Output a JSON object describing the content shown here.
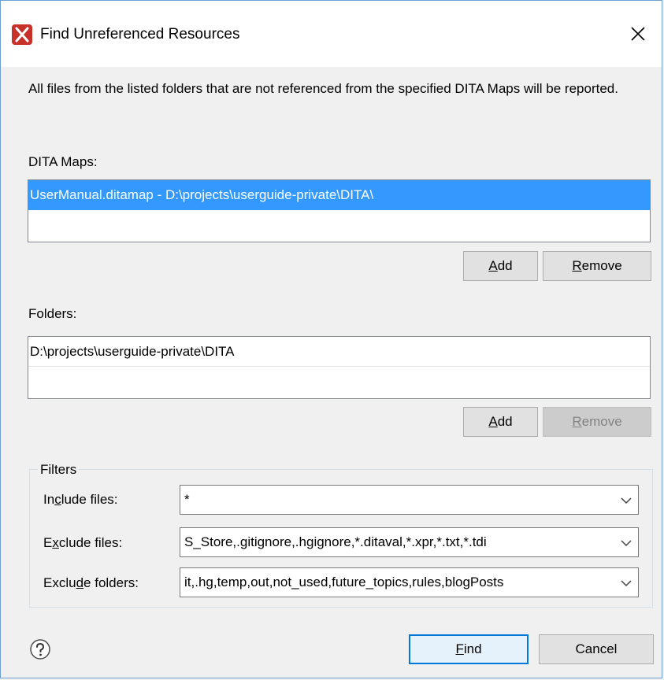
{
  "dialog": {
    "title": "Find Unreferenced Resources",
    "description": "All files from the listed folders that are not referenced from the specified DITA Maps will be reported."
  },
  "dita_maps": {
    "label": "DITA Maps:",
    "items": [
      "UserManual.ditamap - D:\\projects\\userguide-private\\DITA\\"
    ],
    "selected_index": 0,
    "add_button": {
      "mnemonic": "A",
      "rest": "dd"
    },
    "remove_button": {
      "mnemonic": "R",
      "rest": "emove"
    }
  },
  "folders": {
    "label": "Folders:",
    "items": [
      "D:\\projects\\userguide-private\\DITA"
    ],
    "add_button": {
      "mnemonic": "A",
      "rest": "dd"
    },
    "remove_button": {
      "mnemonic": "R",
      "rest": "emove",
      "enabled": false
    }
  },
  "filters": {
    "legend": "Filters",
    "include_files": {
      "label_pre": "In",
      "label_mnemonic": "c",
      "label_post": "lude files:",
      "value": "*"
    },
    "exclude_files": {
      "label_pre": "E",
      "label_mnemonic": "x",
      "label_post": "clude files:",
      "value": "S_Store,.gitignore,.hgignore,*.ditaval,*.xpr,*.txt,*.tdi"
    },
    "exclude_folders": {
      "label_pre": "Exclu",
      "label_mnemonic": "d",
      "label_post": "e folders:",
      "value": "it,.hg,temp,out,not_used,future_topics,rules,blogPosts"
    }
  },
  "footer": {
    "find_button": {
      "mnemonic": "F",
      "rest": "ind"
    },
    "cancel_button": "Cancel"
  },
  "icons": {
    "app": "app-logo-icon",
    "close": "close-icon",
    "help": "help-icon",
    "dropdown": "chevron-down-icon"
  },
  "colors": {
    "selection": "#3399ff",
    "default_button_border": "#0078d7",
    "disabled_text": "#838383"
  }
}
